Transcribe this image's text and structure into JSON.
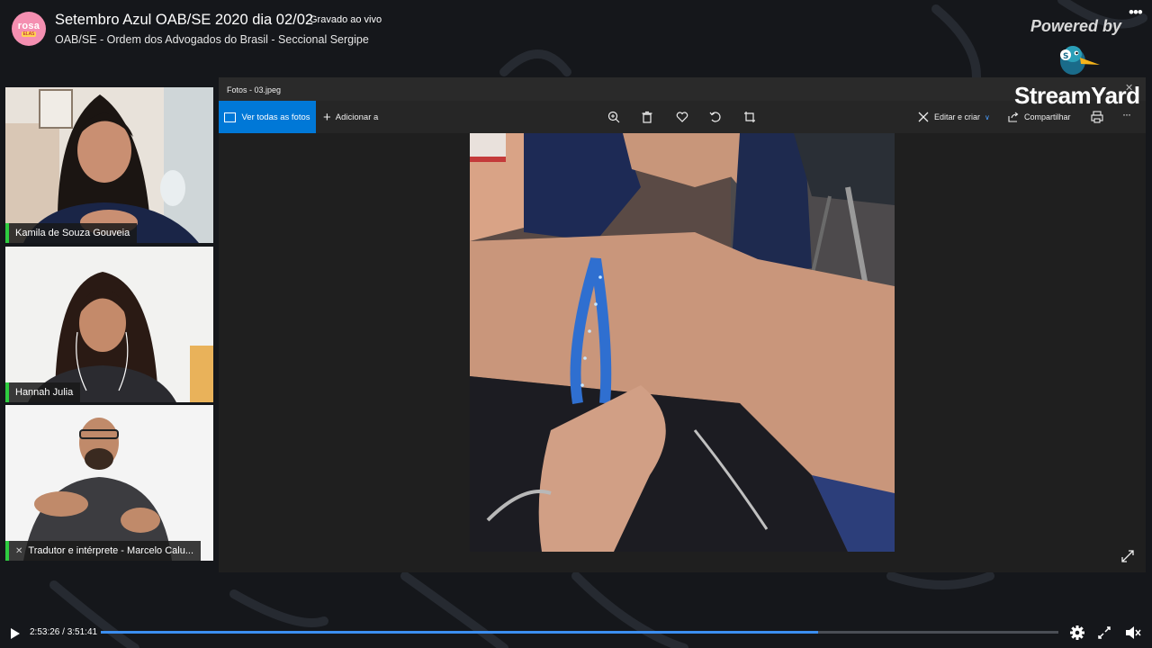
{
  "header": {
    "channel_logo_text": "rosa",
    "channel_logo_sub": "ELAS",
    "title": "Setembro Azul OAB/SE 2020 dia 02/02",
    "live_badge": "Gravado ao vivo",
    "channel": "OAB/SE - Ordem dos Advogados do Brasil - Seccional Sergipe",
    "more_icon": "ellipsis-icon"
  },
  "branding": {
    "powered_by": "Powered by",
    "logo_text": "StreamYard"
  },
  "participants": [
    {
      "name": "Kamila de Souza Gouveia",
      "muted": false
    },
    {
      "name": "Hannah Julia",
      "muted": false
    },
    {
      "name": "Tradutor e intérprete - Marcelo Calu...",
      "muted": true
    }
  ],
  "photos_app": {
    "title": "Fotos - 03.jpeg",
    "view_all": "Ver todas as fotos",
    "add_to": "Adicionar a",
    "edit_create": "Editar e criar",
    "share": "Compartilhar",
    "toolbar_icons": [
      "zoom-icon",
      "delete-icon",
      "heart-icon",
      "rotate-icon",
      "crop-icon"
    ]
  },
  "player": {
    "current_time": "2:53:26",
    "separator": " / ",
    "duration": "3:51:41",
    "progress": 0.749
  },
  "colors": {
    "accent": "#0078d7",
    "progress": "#3b8ef0",
    "speaker_indicator": "#2ecc40",
    "background": "#15171b"
  }
}
